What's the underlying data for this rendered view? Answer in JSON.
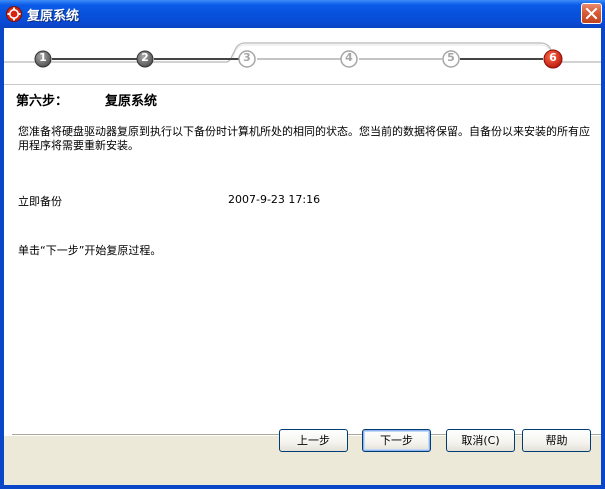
{
  "window": {
    "title": "复原系统",
    "icon": "system-restore-icon",
    "close_icon": "close-icon"
  },
  "steps": {
    "labels": [
      "1",
      "2",
      "3",
      "4",
      "5",
      "6"
    ],
    "current": 6,
    "colors": {
      "done": "#5a5a5a",
      "pending": "#ffffff",
      "current": "#d8230f"
    }
  },
  "heading": {
    "label": "第六步：",
    "name": "复原系统"
  },
  "description": "您准备将硬盘驱动器复原到执行以下备份时计算机所处的相同的状态。您当前的数据将保留。自备份以来安装的所有应用程序将需要重新安装。",
  "backup": {
    "label": "立即备份",
    "time": "2007-9-23 17:16"
  },
  "instruction": "单击“下一步”开始复原过程。",
  "buttons": {
    "back": "上一步",
    "next": "下一步",
    "cancel": "取消(C)",
    "help": "帮助"
  },
  "colors": {
    "titlebar": "#0752dc",
    "frame": "#0a47c8",
    "accent_step": "#d8230f"
  }
}
